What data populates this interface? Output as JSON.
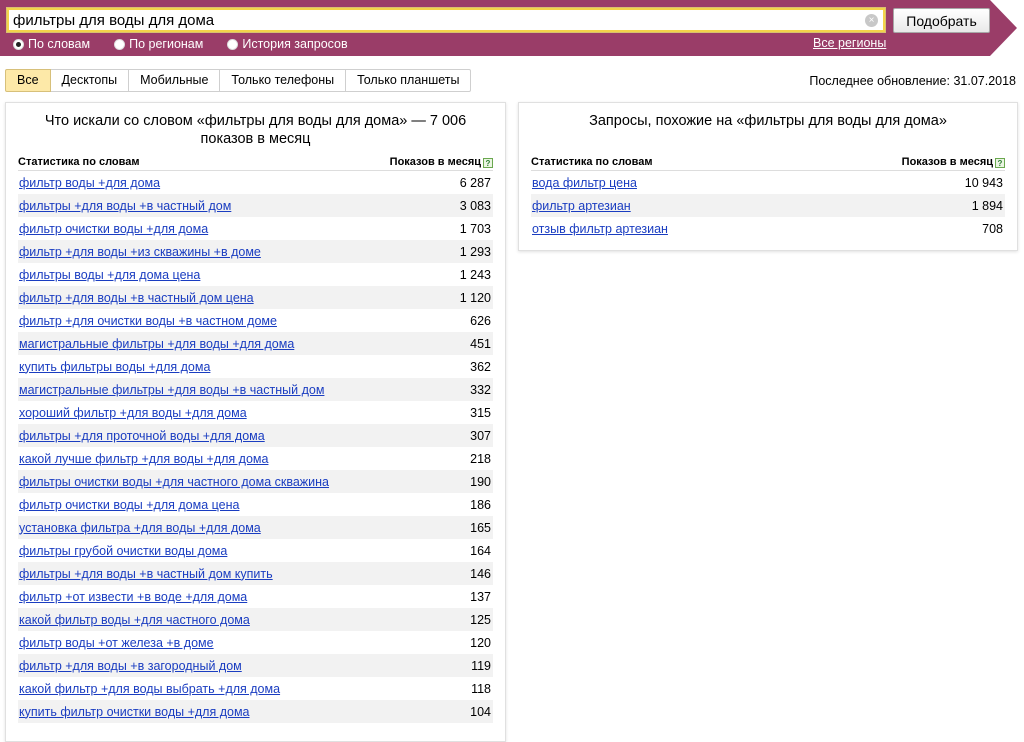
{
  "search": {
    "query": "фильтры для воды для дома",
    "submit_label": "Подобрать",
    "clear_glyph": "×",
    "modes": [
      {
        "label": "По словам",
        "checked": true
      },
      {
        "label": "По регионам",
        "checked": false
      },
      {
        "label": "История запросов",
        "checked": false
      }
    ],
    "regions_link": "Все регионы"
  },
  "tabs": [
    {
      "label": "Все",
      "active": true
    },
    {
      "label": "Десктопы",
      "active": false
    },
    {
      "label": "Мобильные",
      "active": false
    },
    {
      "label": "Только телефоны",
      "active": false
    },
    {
      "label": "Только планшеты",
      "active": false
    }
  ],
  "updated": "Последнее обновление: 31.07.2018",
  "colors": {
    "band": "#9a3d68",
    "link": "#1a3dc1",
    "active_tab": "#fde9a8"
  },
  "left_panel": {
    "title": "Что искали со словом «фильтры для воды для дома» — 7 006 показов в месяц",
    "col_phrase": "Статистика по словам",
    "col_count": "Показов в месяц",
    "help_glyph": "?",
    "rows": [
      {
        "phrase": "фильтр воды +для дома",
        "count": "6 287"
      },
      {
        "phrase": "фильтры +для воды +в частный дом",
        "count": "3 083"
      },
      {
        "phrase": "фильтр очистки воды +для дома",
        "count": "1 703"
      },
      {
        "phrase": "фильтр +для воды +из скважины +в доме",
        "count": "1 293"
      },
      {
        "phrase": "фильтры воды +для дома цена",
        "count": "1 243"
      },
      {
        "phrase": "фильтр +для воды +в частный дом цена",
        "count": "1 120"
      },
      {
        "phrase": "фильтр +для очистки воды +в частном доме",
        "count": "626"
      },
      {
        "phrase": "магистральные фильтры +для воды +для дома",
        "count": "451"
      },
      {
        "phrase": "купить фильтры воды +для дома",
        "count": "362"
      },
      {
        "phrase": "магистральные фильтры +для воды +в частный дом",
        "count": "332"
      },
      {
        "phrase": "хороший фильтр +для воды +для дома",
        "count": "315"
      },
      {
        "phrase": "фильтры +для проточной воды +для дома",
        "count": "307"
      },
      {
        "phrase": "какой лучше фильтр +для воды +для дома",
        "count": "218"
      },
      {
        "phrase": "фильтры очистки воды +для частного дома скважина",
        "count": "190"
      },
      {
        "phrase": "фильтр очистки воды +для дома цена",
        "count": "186"
      },
      {
        "phrase": "установка фильтра +для воды +для дома",
        "count": "165"
      },
      {
        "phrase": "фильтры грубой очистки воды дома",
        "count": "164"
      },
      {
        "phrase": "фильтры +для воды +в частный дом купить",
        "count": "146"
      },
      {
        "phrase": "фильтр +от извести +в воде +для дома",
        "count": "137"
      },
      {
        "phrase": "какой фильтр воды +для частного дома",
        "count": "125"
      },
      {
        "phrase": "фильтр воды +от железа +в доме",
        "count": "120"
      },
      {
        "phrase": "фильтр +для воды +в загородный дом",
        "count": "119"
      },
      {
        "phrase": "какой фильтр +для воды выбрать +для дома",
        "count": "118"
      },
      {
        "phrase": "купить фильтр очистки воды +для дома",
        "count": "104"
      }
    ]
  },
  "right_panel": {
    "title": "Запросы, похожие на «фильтры для воды для дома»",
    "col_phrase": "Статистика по словам",
    "col_count": "Показов в месяц",
    "help_glyph": "?",
    "rows": [
      {
        "phrase": "вода фильтр цена",
        "count": "10 943"
      },
      {
        "phrase": "фильтр артезиан",
        "count": "1 894"
      },
      {
        "phrase": "отзыв фильтр артезиан",
        "count": "708"
      }
    ]
  }
}
